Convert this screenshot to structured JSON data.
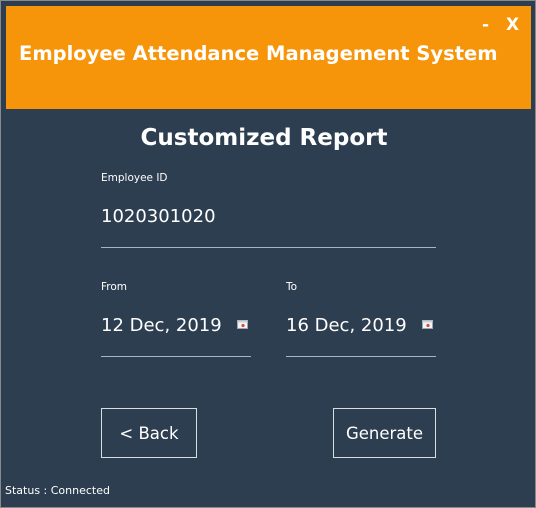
{
  "window": {
    "title": "Employee Attendance Management System",
    "minimize_label": "-",
    "close_label": "X"
  },
  "form": {
    "heading": "Customized Report",
    "employee_id": {
      "label": "Employee ID",
      "value": "1020301020"
    },
    "from": {
      "label": "From",
      "value": "12 Dec, 2019",
      "icon": "calendar-icon"
    },
    "to": {
      "label": "To",
      "value": "16 Dec, 2019",
      "icon": "calendar-icon"
    }
  },
  "actions": {
    "back_label": "< Back",
    "generate_label": "Generate"
  },
  "status": {
    "text": "Status : Connected"
  },
  "colors": {
    "titlebar": "#f7950a",
    "body": "#2d3e50",
    "text": "#ffffff"
  }
}
